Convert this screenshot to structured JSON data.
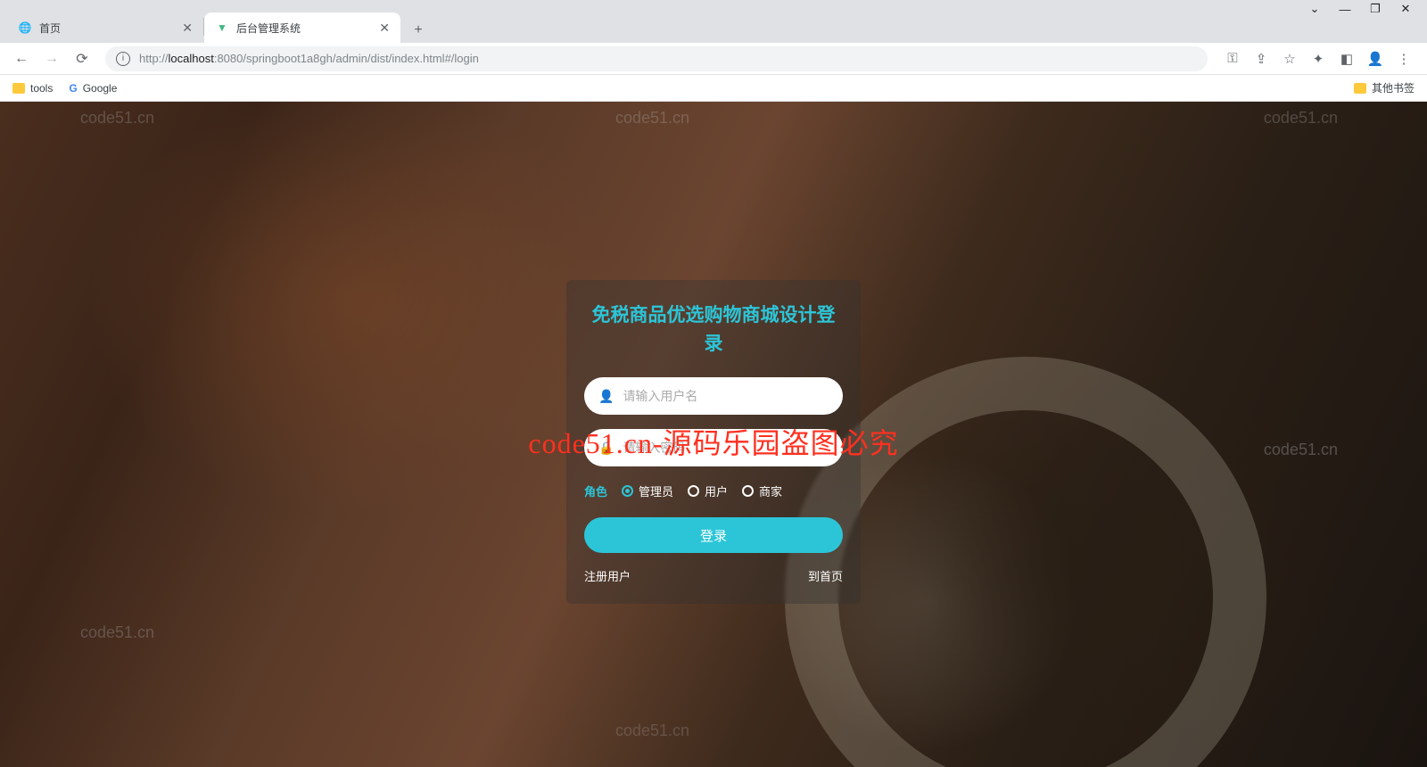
{
  "browser": {
    "tabs": [
      {
        "title": "首页",
        "active": false
      },
      {
        "title": "后台管理系统",
        "active": true
      }
    ],
    "url": "http://localhost:8080/springboot1a8gh/admin/dist/index.html#/login",
    "bookmarks": {
      "tools": "tools",
      "google": "Google",
      "other": "其他书签"
    }
  },
  "watermark": "code51.cn",
  "overlay": "code51.cn-源码乐园盗图必究",
  "login": {
    "title": "免税商品优选购物商城设计登录",
    "username_placeholder": "请输入用户名",
    "password_placeholder": "请输入密码",
    "role_label": "角色",
    "roles": [
      "管理员",
      "用户",
      "商家"
    ],
    "selected_role": "管理员",
    "login_button": "登录",
    "register_link": "注册用户",
    "home_link": "到首页"
  }
}
